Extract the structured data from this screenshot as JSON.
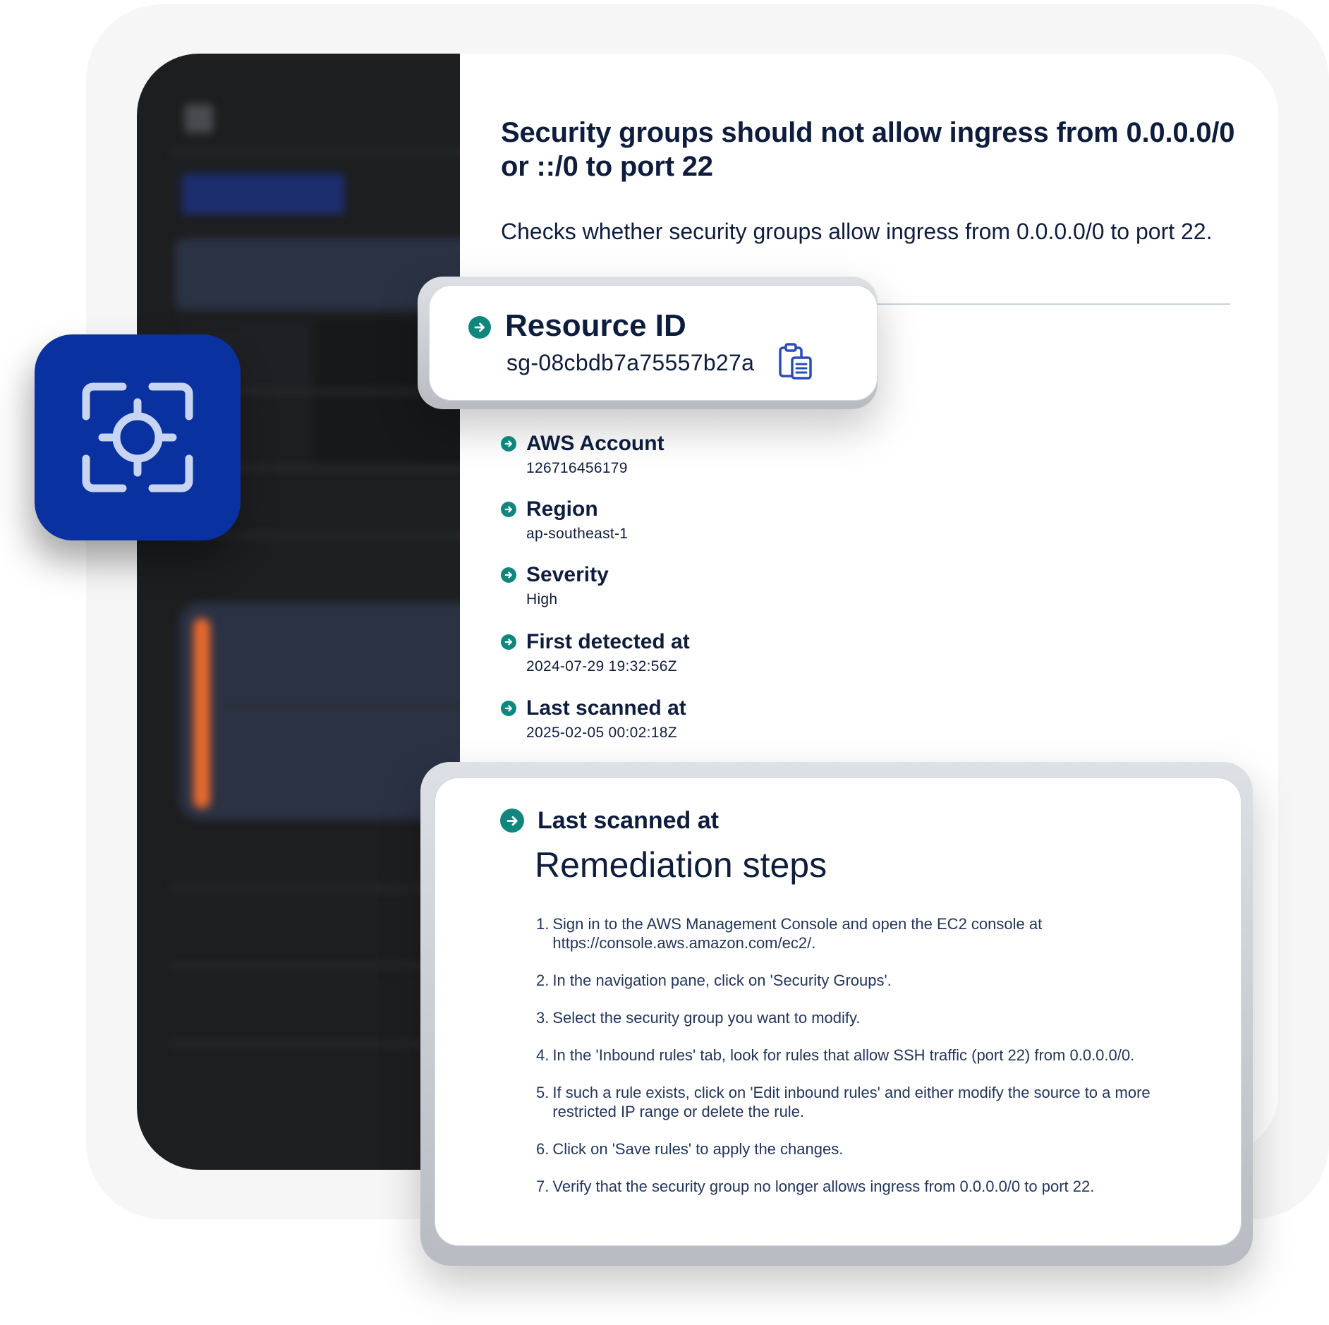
{
  "colors": {
    "accent_teal": "#10867c",
    "app_icon_blue": "#0a31a0",
    "dark_panel": "#1d1e20",
    "text_dark": "#0f1d3d",
    "steps_text": "#22355a",
    "blurred_orange": "#e8692e"
  },
  "icons": {
    "app": "focus-target-icon",
    "bullet": "arrow-right-circle-icon",
    "copy": "clipboard-copy-icon"
  },
  "finding": {
    "title": "Security groups should not allow ingress from 0.0.0.0/0 or ::/0 to port 22",
    "description": "Checks whether security groups allow ingress from 0.0.0.0/0 to port 22."
  },
  "resource": {
    "label": "Resource ID",
    "value": "sg-08cbdb7a75557b27a"
  },
  "fields": [
    {
      "label": "AWS Account",
      "value": "126716456179"
    },
    {
      "label": "Region",
      "value": "ap-southeast-1"
    },
    {
      "label": "Severity",
      "value": "High"
    },
    {
      "label": "First detected at",
      "value": "2024-07-29 19:32:56Z"
    },
    {
      "label": "Last scanned at",
      "value": "2025-02-05 00:02:18Z"
    }
  ],
  "remediation": {
    "label": "Last scanned at",
    "title": "Remediation steps",
    "steps": [
      {
        "num": "1.",
        "text": "Sign in to the AWS Management Console and open the EC2 console at https://console.aws.amazon.com/ec2/."
      },
      {
        "num": "2.",
        "text": "In the navigation pane, click on 'Security Groups'."
      },
      {
        "num": "3.",
        "text": "Select the security group you want to modify."
      },
      {
        "num": "4.",
        "text": "In the 'Inbound rules' tab, look for rules that allow SSH traffic (port 22) from 0.0.0.0/0."
      },
      {
        "num": "5.",
        "text": "If such a rule exists, click on 'Edit inbound rules' and either modify the source to a more restricted IP range or delete the rule."
      },
      {
        "num": "6.",
        "text": "Click on 'Save rules' to apply the changes."
      },
      {
        "num": "7.",
        "text": "Verify that the security group no longer allows ingress from 0.0.0.0/0 to port 22."
      }
    ]
  }
}
